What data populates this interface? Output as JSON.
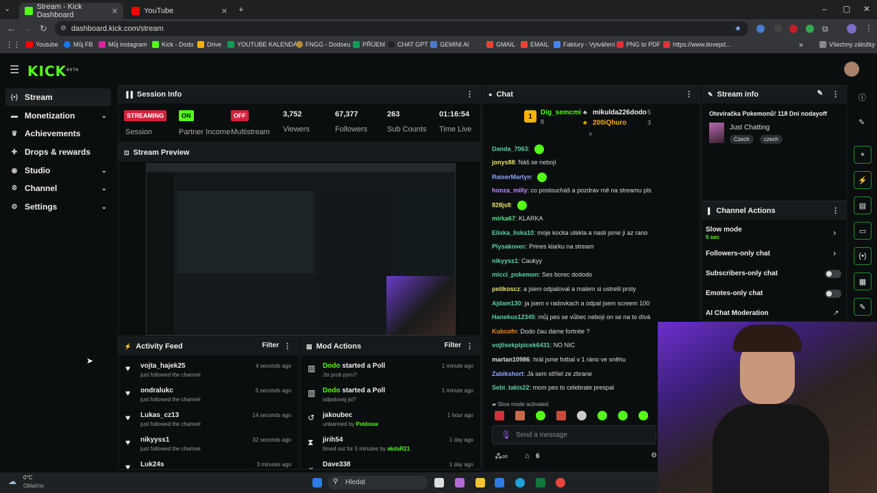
{
  "browser": {
    "tabs": [
      {
        "title": "Stream - Kick Dashboard",
        "active": true
      },
      {
        "title": "YouTube",
        "active": false
      }
    ],
    "url": "dashboard.kick.com/stream",
    "bookmarks": [
      "Youtube",
      "Můj FB",
      "Můj instagram",
      "Kick - Dodo",
      "Drive",
      "YOUTUBE KALENDÁŘ",
      "FNGG - Dodoeu",
      "PŘÍJEM",
      "CHAT GPT",
      "GEMINI AI",
      "GMAIL",
      "EMAIL",
      "Faktury - Vytváření",
      "PNG to PDF",
      "https://www.ilovepd..."
    ],
    "all_bookmarks": "Všechny záložky"
  },
  "kick": {
    "logo": "KICK",
    "beta": "BETA"
  },
  "sidebar": {
    "items": [
      {
        "label": "Stream",
        "icon": "broadcast-icon",
        "active": true
      },
      {
        "label": "Monetization",
        "icon": "money-icon",
        "chevron": true
      },
      {
        "label": "Achievements",
        "icon": "trophy-icon"
      },
      {
        "label": "Drops & rewards",
        "icon": "gift-icon"
      },
      {
        "label": "Studio",
        "icon": "studio-icon",
        "chevron": true
      },
      {
        "label": "Channel",
        "icon": "users-icon",
        "chevron": true
      },
      {
        "label": "Settings",
        "icon": "gear-icon",
        "chevron": true
      }
    ]
  },
  "session_info": {
    "title": "Session Info",
    "stats": [
      {
        "badge": "STREAMING",
        "label": "Session",
        "color": "#d4213a"
      },
      {
        "badge": "ON",
        "label": "Partner Income",
        "color": "#53fc18"
      },
      {
        "badge": "OFF",
        "label": "Multistream",
        "color": "#d4213a"
      },
      {
        "value": "3,752",
        "label": "Viewers"
      },
      {
        "value": "67,377",
        "label": "Followers"
      },
      {
        "value": "263",
        "label": "Sub Counts"
      },
      {
        "value": "01:16:54",
        "label": "Time Live"
      }
    ]
  },
  "stream_preview": {
    "title": "Stream Preview"
  },
  "activity_feed": {
    "title": "Activity Feed",
    "filter": "Filter",
    "rows": [
      {
        "user": "vojta_hajek25",
        "action": "just followed the channel",
        "time": "4 seconds ago"
      },
      {
        "user": "ondralukc",
        "action": "just followed the channel",
        "time": "5 seconds ago"
      },
      {
        "user": "Lukas_cz13",
        "action": "just followed the channel",
        "time": "14 seconds ago"
      },
      {
        "user": "nikyyss1",
        "action": "just followed the channel",
        "time": "32 seconds ago"
      },
      {
        "user": "Luk24s",
        "action": "",
        "time": "3 minutes ago"
      }
    ]
  },
  "mod_actions": {
    "title": "Mod Actions",
    "filter": "Filter",
    "rows": [
      {
        "user": "Dodo",
        "action": "started a Poll",
        "detail": "Jsi proti pyru?",
        "time": "1 minute ago",
        "icon": "poll-icon"
      },
      {
        "user": "Dodo",
        "action": "started a Poll",
        "detail": "odpalovaj jsi?",
        "time": "1 minute ago",
        "icon": "poll-icon"
      },
      {
        "user": "jakoubec",
        "action": "",
        "detail": "unbanned by",
        "by": "Peldosw",
        "time": "1 hour ago",
        "icon": "unban-icon"
      },
      {
        "user": "jirih54",
        "action": "",
        "detail": "timed out for 5 minutes by",
        "by": "akdaR21",
        "time": "1 day ago",
        "icon": "hourglass-icon"
      },
      {
        "user": "Dave338",
        "action": "",
        "detail": "",
        "time": "1 day ago",
        "icon": "chevron-icon"
      }
    ]
  },
  "chat": {
    "title": "Chat",
    "top_gifters": [
      {
        "rank": "1",
        "name": "Dig_semcmi",
        "count": "8"
      },
      {
        "name": "mikulda226dodo",
        "count": "5"
      },
      {
        "name": "200iQhuro",
        "count": "3"
      }
    ],
    "messages": [
      {
        "user": "Danda_7063",
        "text": "",
        "color": "#5ad3a5"
      },
      {
        "user": "jonys88",
        "text": "Náš se nebojí",
        "color": "#e8e26a"
      },
      {
        "user": "RaiserMartyn",
        "text": "",
        "color": "#8ea6ff"
      },
      {
        "user": "honza_milly",
        "text": "co posloucháš a pozdrav mě na streamu pls",
        "color": "#c48bff"
      },
      {
        "user": "828js8",
        "text": "",
        "color": "#e8e26a"
      },
      {
        "user": "mirka67",
        "text": "KLARKA",
        "color": "#5de08a"
      },
      {
        "user": "Eliska_liska10",
        "text": "moje kocka utekla a nasli jsme ji az rano",
        "color": "#5ad3a5"
      },
      {
        "user": "Plysakovec",
        "text": "Prines klarku na stream",
        "color": "#5ad3a5"
      },
      {
        "user": "nikyyss1",
        "text": "Caukyy",
        "color": "#5ad3a5"
      },
      {
        "user": "micci_pokemon",
        "text": "Ses borec dododo",
        "color": "#5ad3a5"
      },
      {
        "user": "petikoscz",
        "text": "a jsem odpaloval a malem si ustrelil prsty",
        "color": "#e8e26a"
      },
      {
        "user": "Ajdam130",
        "text": "ja jsem v radovkach a odpal jsem screem 100",
        "color": "#5ad3a5"
      },
      {
        "user": "Hanekus12345",
        "text": "můj pes se vůbec nebojí on se na to dívá",
        "color": "#5ad3a5"
      },
      {
        "user": "Kubcofn",
        "text": "Dodo čau dáme fortnite ?",
        "color": "#f08a24"
      },
      {
        "user": "vojtisekpipicek6431",
        "text": "NO NIC",
        "color": "#5ad3a5"
      },
      {
        "user": "martan10986",
        "text": "hrál jsme fotbal v 1 ráno ve sněhu",
        "color": "#ddd"
      },
      {
        "user": "Zabikshort",
        "text": "Já sem střílel ze zbrane",
        "color": "#8ea6ff"
      },
      {
        "user": "Sebi_takis22",
        "text": "mom pes to celebrate prespal",
        "color": "#5ad3a5"
      }
    ],
    "slow_mode_notice": "Slow mode activated",
    "placeholder": "Send a message",
    "footer_count": "6"
  },
  "stream_info": {
    "title": "Stream info",
    "stream_title": "Otevíračka Pokemonů! 118 Dní nodayoff",
    "category": "Just Chatting",
    "tags": [
      "Czech",
      "czech"
    ]
  },
  "channel_actions": {
    "title": "Channel Actions",
    "rows": [
      {
        "label": "Slow mode",
        "sub": "5 sec",
        "type": "chevron"
      },
      {
        "label": "Followers-only chat",
        "type": "chevron"
      },
      {
        "label": "Subscribers-only chat",
        "type": "toggle"
      },
      {
        "label": "Emotes-only chat",
        "type": "toggle"
      },
      {
        "label": "AI Chat Moderation",
        "type": "external"
      }
    ]
  },
  "taskbar": {
    "weather_temp": "0°C",
    "weather_desc": "Oblačno",
    "search": "Hledat"
  }
}
